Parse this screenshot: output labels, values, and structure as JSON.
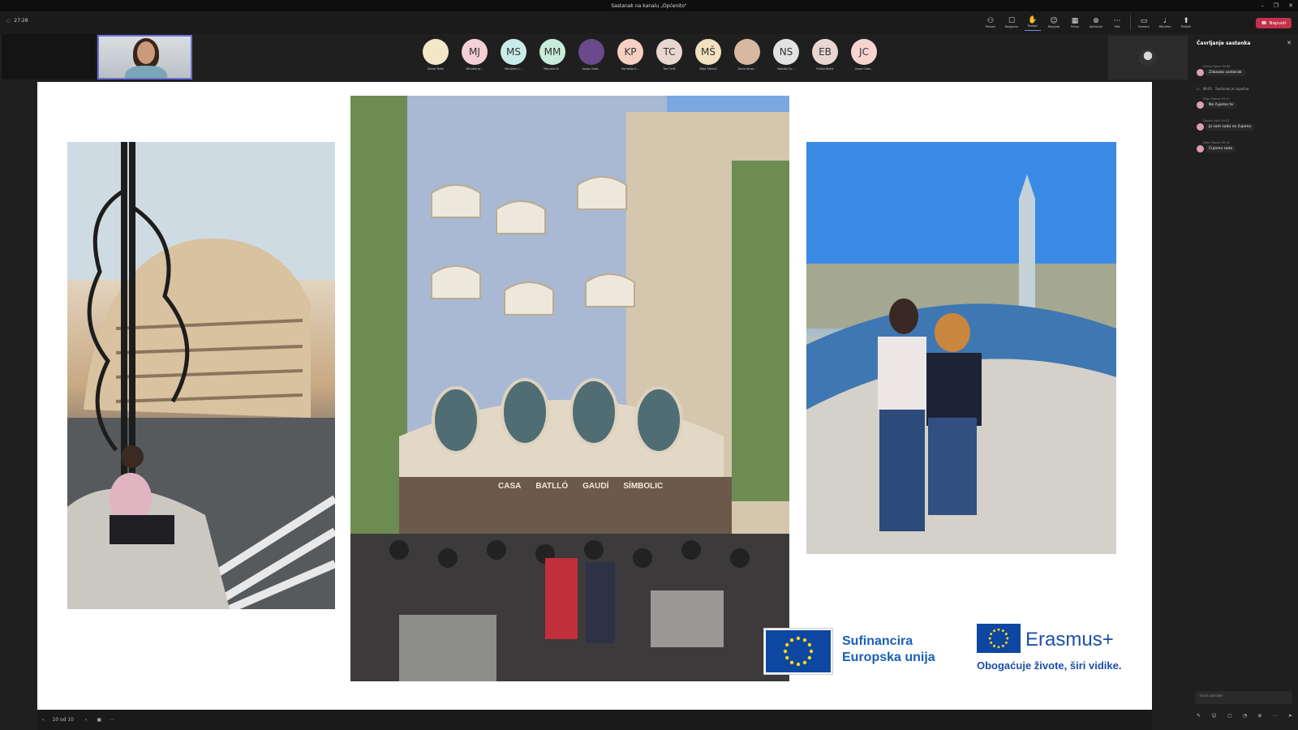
{
  "window": {
    "title": "Sastanak na kanalu „Općenito\"",
    "controls": [
      "–",
      "❐",
      "✕"
    ]
  },
  "topbar": {
    "timer": "27:28",
    "toolbar": [
      {
        "icon": "people-icon",
        "glyph": "⚇",
        "label": "Personi"
      },
      {
        "icon": "chat-icon",
        "glyph": "☐",
        "label": "Razgovor"
      },
      {
        "icon": "raise-hand-icon",
        "glyph": "✋",
        "label": "Podigni"
      },
      {
        "icon": "reactions-icon",
        "glyph": "☺",
        "label": "Reagiraj"
      },
      {
        "icon": "view-icon",
        "glyph": "▦",
        "label": "Prikaz"
      },
      {
        "icon": "apps-icon",
        "glyph": "⊕",
        "label": "Aplikacije"
      },
      {
        "icon": "more-icon",
        "glyph": "⋯",
        "label": "Više"
      },
      {
        "icon": "camera-icon",
        "glyph": "▭",
        "label": "Kamera"
      },
      {
        "icon": "microphone-icon",
        "glyph": "♩",
        "label": "Mikrofon"
      },
      {
        "icon": "share-icon",
        "glyph": "⬆",
        "label": "Podijeli"
      }
    ],
    "leave_label": "Napusti"
  },
  "participants": [
    {
      "initials": "",
      "name": "Diana Talan",
      "color": "#f3e7c9"
    },
    {
      "initials": "MJ",
      "name": "Mihaela Ja...",
      "color": "#f4cfd5"
    },
    {
      "initials": "MS",
      "name": "Marijana S...",
      "color": "#c9ece8"
    },
    {
      "initials": "MM",
      "name": "Marcela M...",
      "color": "#c8ecd8"
    },
    {
      "initials": "",
      "name": "Vanja Ozeb...",
      "color": "#6a4a8a"
    },
    {
      "initials": "KP",
      "name": "Kornelija K...",
      "color": "#f7cfc1"
    },
    {
      "initials": "TC",
      "name": "Tea Celić",
      "color": "#ead6d1"
    },
    {
      "initials": "MŠ",
      "name": "Maja Šikanić",
      "color": "#f3e0c0"
    },
    {
      "initials": "",
      "name": "Dario Ibran...",
      "color": "#d7b9a0"
    },
    {
      "initials": "NS",
      "name": "Nataša Su...",
      "color": "#e2e2e2"
    },
    {
      "initials": "EB",
      "name": "Eržika Bakić",
      "color": "#ead6d1"
    },
    {
      "initials": "JC",
      "name": "Ivana Ćeko...",
      "color": "#f8d4d0"
    }
  ],
  "slide": {
    "logo_eu_line1": "Sufinancira",
    "logo_eu_line2": "Europska unija",
    "logo_erasmus_name": "Erasmus+",
    "logo_erasmus_tagline": "Obogaćuje živote, širi vidike.",
    "sign_words": [
      "CASA",
      "BATLLÓ",
      "GAUDÍ",
      "SÍMBOLIC"
    ]
  },
  "bottombar": {
    "page": "10 od 10"
  },
  "chat": {
    "title": "Čavrljanje sastanka",
    "system_time": "09:01",
    "system_text": "Sastanak je započeo",
    "messages": [
      {
        "meta": "Dorina Tobor 09:06",
        "text": "Zakazao sastanak"
      },
      {
        "meta": "Maja Šikanić 09:11",
        "text": "Ne čujemo te"
      },
      {
        "meta": "Dorina Ćolić 09:22",
        "text": "Ja sam sada ne čujemo"
      },
      {
        "meta": "Maja Šikanić 09:42",
        "text": "Čujemo sada"
      }
    ],
    "input_placeholder": "Unos poruke"
  }
}
